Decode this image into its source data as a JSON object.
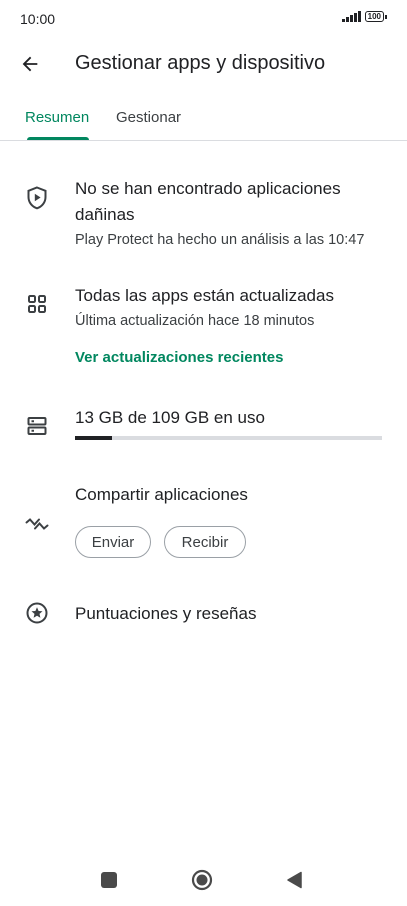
{
  "status_bar": {
    "time": "10:00",
    "battery": "100"
  },
  "header": {
    "title": "Gestionar apps y dispositivo"
  },
  "tabs": [
    {
      "label": "Resumen"
    },
    {
      "label": "Gestionar"
    }
  ],
  "play_protect": {
    "line1": "No se han encontrado aplicaciones",
    "line2": "dañinas",
    "detail": "Play Protect ha hecho un análisis a las 10:47"
  },
  "updates": {
    "title": "Todas las apps están actualizadas",
    "detail": "Última actualización hace 18 minutos",
    "link": "Ver actualizaciones recientes"
  },
  "storage": {
    "label": "13 GB de 109 GB en uso",
    "used_fraction": 0.12
  },
  "share": {
    "title": "Compartir aplicaciones",
    "send": "Enviar",
    "receive": "Recibir"
  },
  "ratings": {
    "title": "Puntuaciones y reseñas"
  },
  "colors": {
    "accent": "#01875f",
    "text": "#202124",
    "divider": "#dadce0"
  }
}
